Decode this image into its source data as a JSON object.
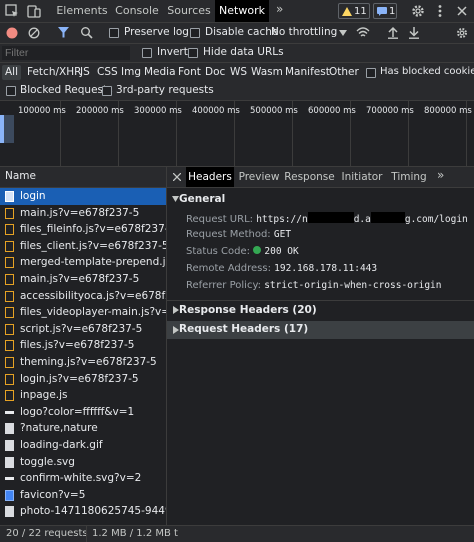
{
  "tabs": [
    "Elements",
    "Console",
    "Sources",
    "Network"
  ],
  "badges": {
    "warnings": "11",
    "messages": "1"
  },
  "toolbar": {
    "preserve_log": "Preserve log",
    "disable_cache": "Disable cache",
    "throttle": "No throttling"
  },
  "filter": {
    "placeholder": "Filter",
    "invert": "Invert",
    "hide_data_urls": "Hide data URLs"
  },
  "types": [
    "All",
    "Fetch/XHR",
    "JS",
    "CSS",
    "Img",
    "Media",
    "Font",
    "Doc",
    "WS",
    "Wasm",
    "Manifest",
    "Other"
  ],
  "has_blocked_cookies": "Has blocked cookies",
  "blocked_requests": "Blocked Requests",
  "third_party": "3rd-party requests",
  "timeline_labels": [
    "100000 ms",
    "200000 ms",
    "300000 ms",
    "400000 ms",
    "500000 ms",
    "600000 ms",
    "700000 ms",
    "800000 ms"
  ],
  "list": {
    "header": "Name",
    "rows": [
      {
        "name": "login",
        "type": "doc"
      },
      {
        "name": "main.js?v=e678f237-5",
        "type": "js"
      },
      {
        "name": "files_fileinfo.js?v=e678f237-5",
        "type": "js"
      },
      {
        "name": "files_client.js?v=e678f237-5",
        "type": "js"
      },
      {
        "name": "merged-template-prepend.js?v...",
        "type": "js"
      },
      {
        "name": "main.js?v=e678f237-5",
        "type": "js"
      },
      {
        "name": "accessibilityoca.js?v=e678f237-5",
        "type": "js"
      },
      {
        "name": "files_videoplayer-main.js?v=e67...",
        "type": "js"
      },
      {
        "name": "script.js?v=e678f237-5",
        "type": "js"
      },
      {
        "name": "files.js?v=e678f237-5",
        "type": "js"
      },
      {
        "name": "theming.js?v=e678f237-5",
        "type": "js"
      },
      {
        "name": "login.js?v=e678f237-5",
        "type": "js"
      },
      {
        "name": "inpage.js",
        "type": "js"
      },
      {
        "name": "logo?color=ffffff&v=1",
        "type": "dash"
      },
      {
        "name": "?nature,nature",
        "type": "img"
      },
      {
        "name": "loading-dark.gif",
        "type": "img"
      },
      {
        "name": "toggle.svg",
        "type": "img"
      },
      {
        "name": "confirm-white.svg?v=2",
        "type": "dash"
      },
      {
        "name": "favicon?v=5",
        "type": "fav"
      },
      {
        "name": "photo-1471180625745-944903...",
        "type": "img"
      }
    ]
  },
  "status": {
    "requests": "20 / 22 requests",
    "transferred": "1.2 MB / 1.2 MB t"
  },
  "detail": {
    "tabs": [
      "Headers",
      "Preview",
      "Response",
      "Initiator",
      "Timing"
    ],
    "general_title": "General",
    "fields": [
      {
        "label": "Request URL:",
        "value_parts": [
          "https://n",
          "d.a",
          "g.com/login"
        ]
      },
      {
        "label": "Request Method:",
        "value": "GET"
      },
      {
        "label": "Status Code:",
        "value": "200 OK"
      },
      {
        "label": "Remote Address:",
        "value": "192.168.178.11:443"
      },
      {
        "label": "Referrer Policy:",
        "value": "strict-origin-when-cross-origin"
      }
    ],
    "response_headers": "Response Headers (20)",
    "request_headers": "Request Headers (17)"
  },
  "colors": {
    "accent": "#8ab4f8",
    "selected_row": "#1a5fb4",
    "record_red": "#f28b82",
    "status_green": "#34a853",
    "warning": "#fdd663"
  }
}
